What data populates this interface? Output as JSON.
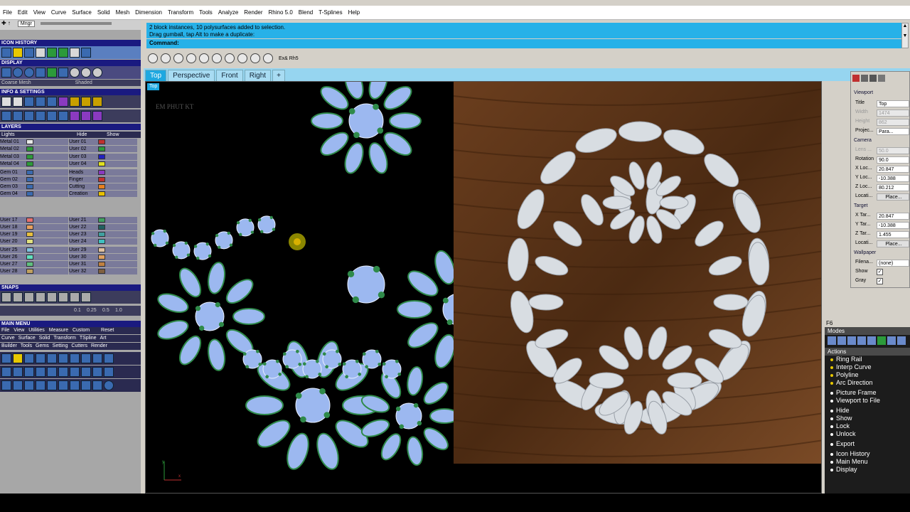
{
  "menu": [
    "File",
    "Edit",
    "View",
    "Curve",
    "Surface",
    "Solid",
    "Mesh",
    "Dimension",
    "Transform",
    "Tools",
    "Analyze",
    "Render",
    "Rhino 5.0",
    "Blend",
    "T-Splines",
    "Help"
  ],
  "command": {
    "history_line1": "2 block instances, 10 polysurfaces added to selection.",
    "history_line2": "Drag gumball, tap Alt to make a duplicate:",
    "prompt": "Command:"
  },
  "view_toolbar": {
    "label": "Ex& Rh5"
  },
  "tabs": [
    "Top",
    "Perspective",
    "Front",
    "Right",
    "+"
  ],
  "viewport": {
    "label": "Top",
    "watermark": "EM PHUT KT"
  },
  "left_panel": {
    "sections": {
      "icon_history": "ICON HISTORY",
      "display": "DISPLAY",
      "info": "INFO & SETTINGS",
      "layers": "LAYERS",
      "snaps": "SNAPS",
      "main_menu": "MAIN MENU"
    },
    "display_modes": [
      "Coarse Mesh",
      "Shaded"
    ],
    "mngr": "Mngr",
    "layers_top": {
      "lights": "Lights",
      "hide": "Hide",
      "show": "Show"
    },
    "layers_left": [
      "Metal 01",
      "Metal 02",
      "Metal 03",
      "Metal 04",
      "Gem 01",
      "Gem 02",
      "Gem 03",
      "Gem 04",
      "User 17",
      "User 18",
      "User 19",
      "User 20",
      "User 25",
      "User 26",
      "User 27",
      "User 28"
    ],
    "layers_right": [
      "User 01",
      "User 02",
      "User 03",
      "User 04",
      "Heads",
      "Finger",
      "Cutting",
      "Creation",
      "User 21",
      "User 22",
      "User 23",
      "User 24",
      "User 29",
      "User 30",
      "User 31",
      "User 32"
    ],
    "snap_values": [
      "0.1",
      "0.25",
      "0.5",
      "1.0"
    ],
    "main_menu_row1": [
      "File",
      "View",
      "Utilities",
      "Measure",
      "Custom",
      "Reset"
    ],
    "main_menu_row2": [
      "Curve",
      "Surface",
      "Solid",
      "Transform",
      "TSpline",
      "Art"
    ],
    "main_menu_row3": [
      "Builder",
      "Tools",
      "Gems",
      "Setting",
      "Cutters",
      "Render"
    ]
  },
  "properties": {
    "viewport_hdr": "Viewport",
    "title_k": "Title",
    "title_v": "Top",
    "width_k": "Width",
    "width_v": "1474",
    "height_k": "Height",
    "height_v": "862",
    "proj_k": "Projec...",
    "proj_v": "Para...",
    "camera_hdr": "Camera",
    "lens_k": "Lens ...",
    "lens_v": "50.0",
    "rot_k": "Rotation",
    "rot_v": "90.0",
    "xloc_k": "X Loc...",
    "xloc_v": "20.847",
    "yloc_k": "Y Loc...",
    "yloc_v": "-10.388",
    "zloc_k": "Z Loc...",
    "zloc_v": "80.212",
    "loc_k": "Locati...",
    "loc_v": "Place...",
    "target_hdr": "Target",
    "xtar_k": "X Tar...",
    "xtar_v": "20.847",
    "ytar_k": "Y Tar...",
    "ytar_v": "-10.388",
    "ztar_k": "Z Tar...",
    "ztar_v": "1.455",
    "tloc_k": "Locati...",
    "tloc_v": "Place...",
    "wallpaper_hdr": "Wallpaper",
    "file_k": "Filena...",
    "file_v": "(none)",
    "show_k": "Show",
    "gray_k": "Gray"
  },
  "f6": {
    "title": "F6",
    "modes": "Modes",
    "actions": "Actions",
    "items": [
      "Ring Rail",
      "Interp Curve",
      "Polyline",
      "Arc Direction",
      "Picture Frame",
      "Viewport to File",
      "Hide",
      "Show",
      "Lock",
      "Unlock",
      "Export",
      "Icon History",
      "Main Menu",
      "Display"
    ]
  },
  "colors": {
    "accent": "#27b1e8",
    "gem_fill": "#9cb8f0",
    "prong": "#2f8a4a",
    "wood": "#5a3418"
  }
}
